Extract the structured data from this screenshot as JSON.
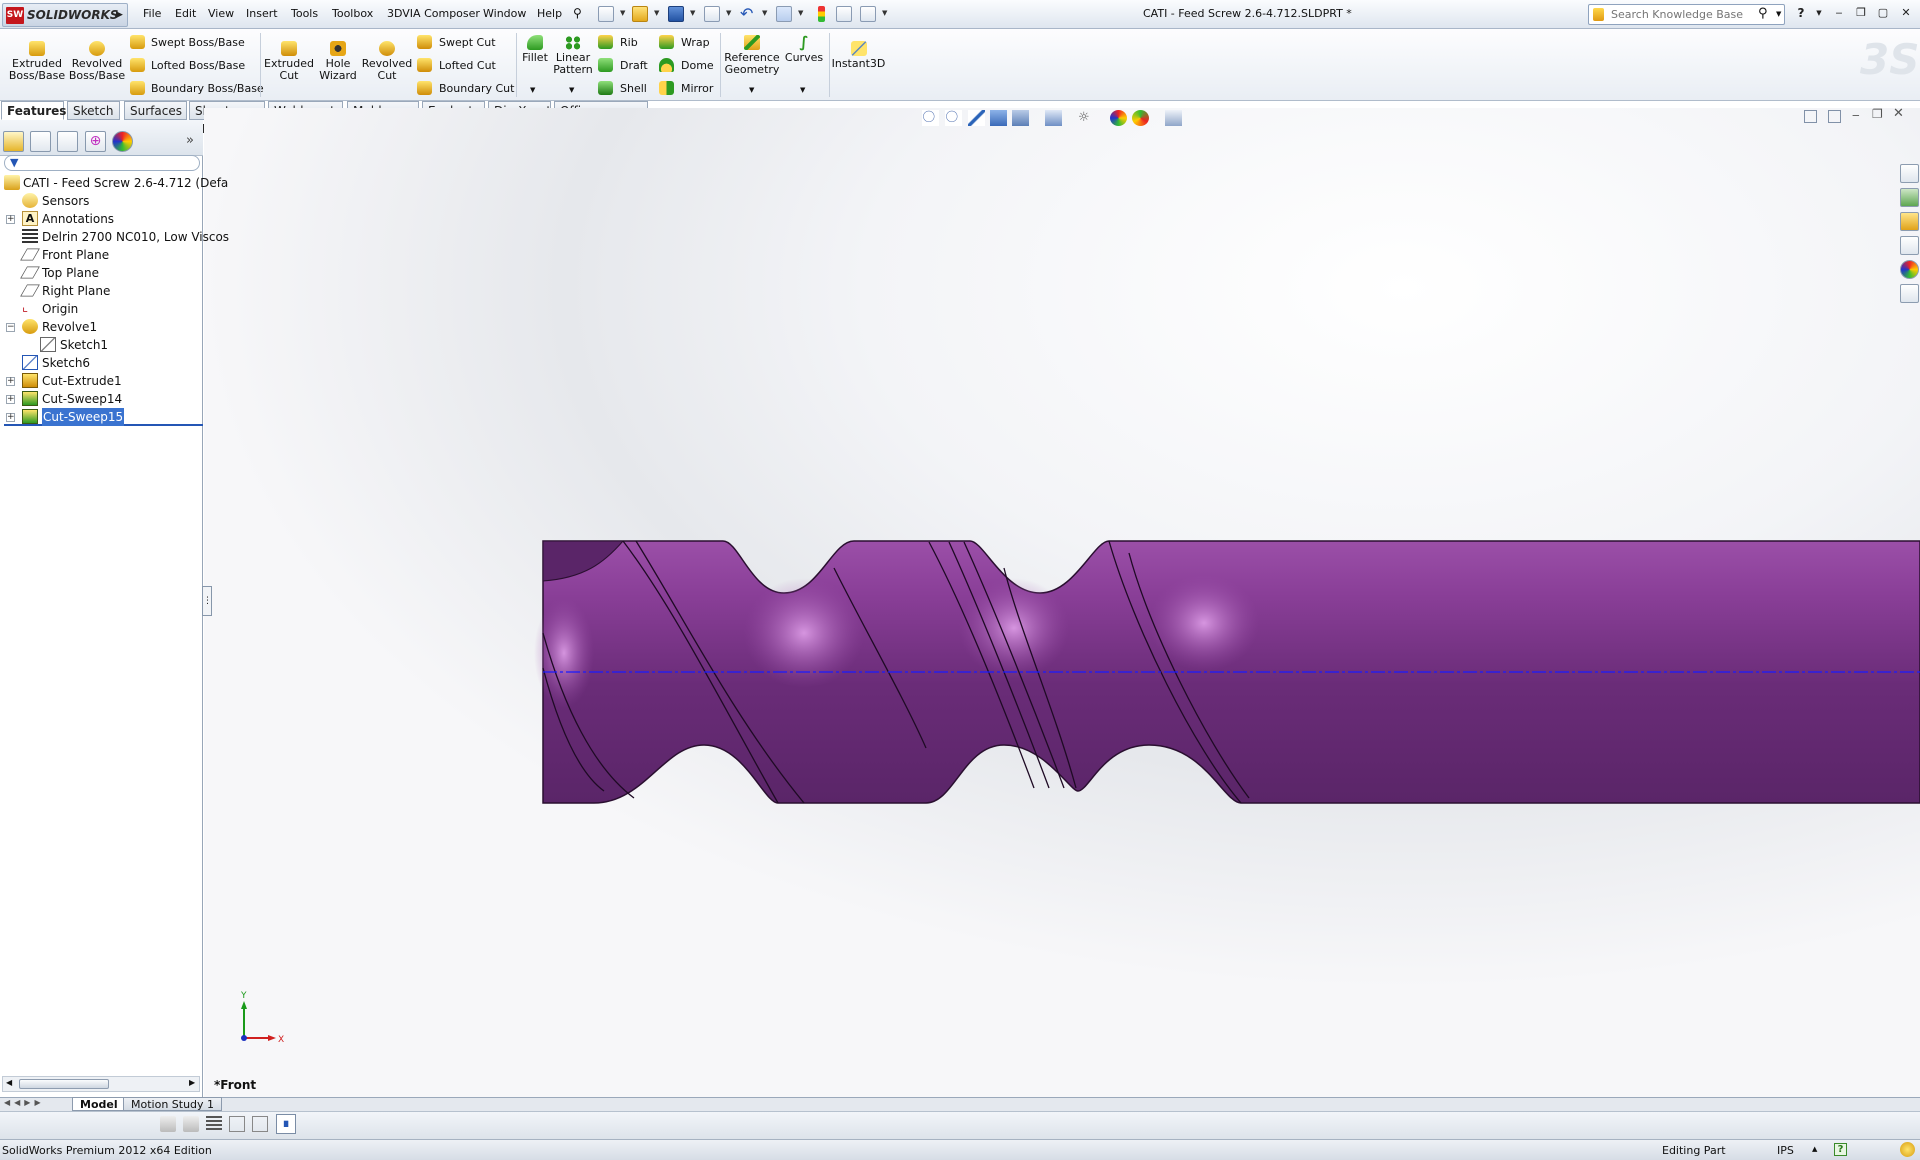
{
  "app": {
    "logo_text": "SOLIDWORKS",
    "logo_badge": "SW",
    "window_title": "CATI - Feed Screw 2.6-4.712.SLDPRT *"
  },
  "menu": [
    "File",
    "Edit",
    "View",
    "Insert",
    "Tools",
    "Toolbox",
    "3DVIA Composer",
    "Window",
    "Help"
  ],
  "search": {
    "placeholder": "Search Knowledge Base"
  },
  "help_label": "?",
  "commands": {
    "extruded_boss": "Extruded\nBoss/Base",
    "revolved_boss": "Revolved\nBoss/Base",
    "swept_boss": "Swept Boss/Base",
    "lofted_boss": "Lofted Boss/Base",
    "boundary_boss": "Boundary Boss/Base",
    "extruded_cut": "Extruded\nCut",
    "hole_wizard": "Hole\nWizard",
    "revolved_cut": "Revolved\nCut",
    "swept_cut": "Swept Cut",
    "lofted_cut": "Lofted Cut",
    "boundary_cut": "Boundary Cut",
    "fillet": "Fillet",
    "linear_pattern": "Linear\nPattern",
    "rib": "Rib",
    "draft": "Draft",
    "shell": "Shell",
    "wrap": "Wrap",
    "dome": "Dome",
    "mirror": "Mirror",
    "reference_geometry": "Reference\nGeometry",
    "curves": "Curves",
    "instant3d": "Instant3D"
  },
  "tabs": [
    "Features",
    "Sketch",
    "Surfaces",
    "Sheet Metal",
    "Weldments",
    "Mold Tools",
    "Evaluate",
    "DimXpert",
    "Office Products"
  ],
  "active_tab": "Features",
  "tree": {
    "root": "CATI - Feed Screw 2.6-4.712  (Defa",
    "items": [
      {
        "label": "Sensors",
        "icon": "sensor-icon"
      },
      {
        "label": "Annotations",
        "icon": "annotation-icon"
      },
      {
        "label": "Delrin 2700 NC010, Low Viscos",
        "icon": "material-icon"
      },
      {
        "label": "Front Plane",
        "icon": "plane-icon"
      },
      {
        "label": "Top Plane",
        "icon": "plane-icon"
      },
      {
        "label": "Right Plane",
        "icon": "plane-icon"
      },
      {
        "label": "Origin",
        "icon": "origin-icon"
      },
      {
        "label": "Revolve1",
        "icon": "revolve-icon"
      },
      {
        "label": "Sketch1",
        "icon": "sketch-icon"
      },
      {
        "label": "Sketch6",
        "icon": "sketch-icon"
      },
      {
        "label": "Cut-Extrude1",
        "icon": "cut-extrude-icon"
      },
      {
        "label": "Cut-Sweep14",
        "icon": "cut-sweep-icon"
      },
      {
        "label": "Cut-Sweep15",
        "icon": "cut-sweep-icon",
        "selected": true
      }
    ]
  },
  "viewport": {
    "view_name": "*Front",
    "triad_x": "X",
    "triad_y": "Y",
    "part_color": "#6e2f7a",
    "axis_color": "#1a1aff"
  },
  "bottom_tabs": [
    "Model",
    "Motion Study 1"
  ],
  "active_bottom_tab": "Model",
  "status": {
    "edition": "SolidWorks Premium 2012 x64 Edition",
    "mode": "Editing Part",
    "units": "IPS",
    "help": "?"
  }
}
